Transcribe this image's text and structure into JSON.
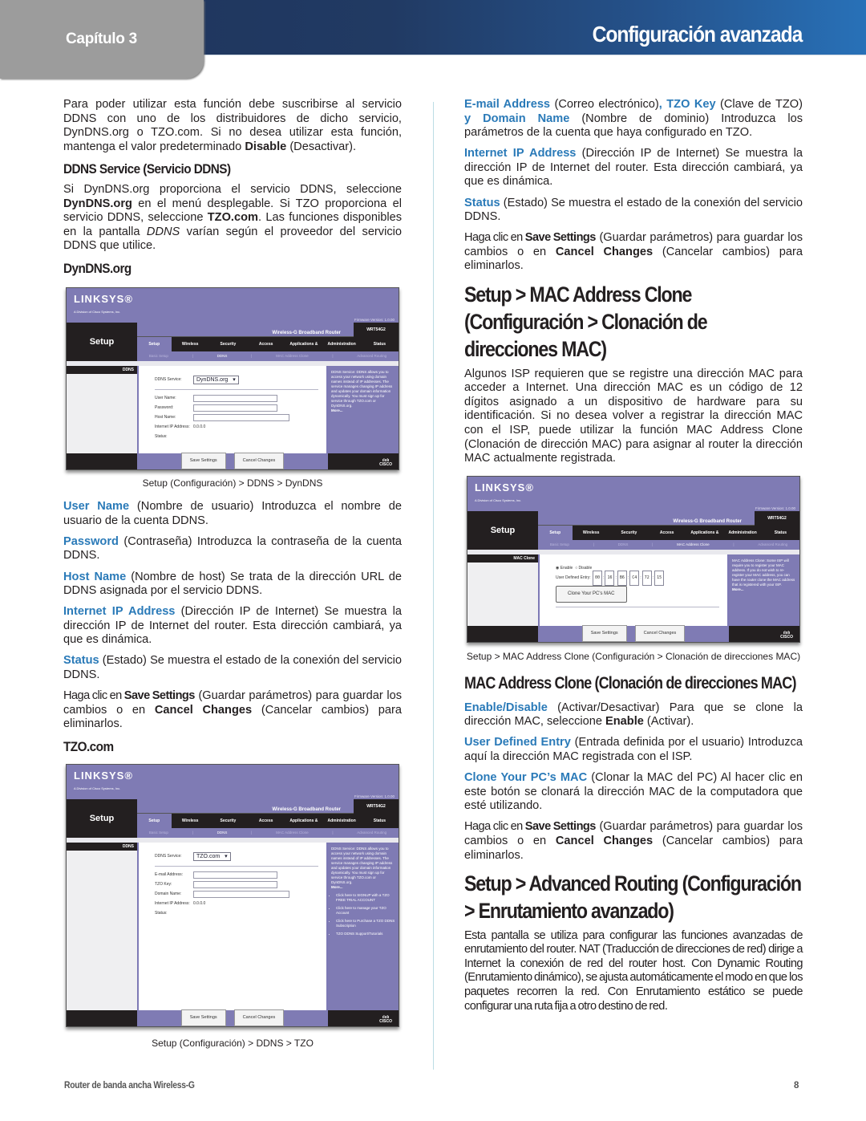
{
  "header": {
    "chapter_label": "Capítulo 3",
    "title": "Configuración avanzada"
  },
  "left": {
    "intro": "Para poder utilizar esta función debe suscribirse al servicio DDNS con uno de los distribuidores de dicho servicio, DynDNS.org o TZO.com. Si no desea utilizar esta función, mantenga el valor predeterminado ",
    "intro_bold": "Disable",
    "intro_tail": " (Desactivar).",
    "ddns_service_heading": "DDNS Service (Servicio DDNS)",
    "ddns_p1": "Si DynDNS.org proporciona el servicio DDNS, seleccione ",
    "ddns_p1_b1": "DynDNS.org",
    "ddns_p1_m": " en el menú desplegable. Si TZO proporciona el servicio DDNS, seleccione ",
    "ddns_p1_b2": "TZO.com",
    "ddns_p1_m2": ". Las funciones disponibles en la pantalla ",
    "ddns_p1_i": "DDNS",
    "ddns_p1_tail": " varían según el proveedor del servicio DDNS que utilice.",
    "dyndns_heading": "DynDNS.org",
    "caption1": "Setup (Configuración) > DDNS > DynDNS",
    "items": [
      {
        "term": "User Name",
        "text": " (Nombre de usuario) Introduzca el nombre de usuario de la cuenta DDNS."
      },
      {
        "term": "Password",
        "text": " (Contraseña) Introduzca la contraseña de la cuenta DDNS."
      },
      {
        "term": "Host Name",
        "text": " (Nombre de host) Se trata de la dirección URL de DDNS asignada por el servicio DDNS."
      },
      {
        "term": "Internet IP Address",
        "text": " (Dirección IP de Internet) Se muestra la dirección IP de Internet del router. Esta dirección cambiará, ya que es dinámica."
      },
      {
        "term": "Status",
        "text": " (Estado) Se muestra el estado de la conexión del servicio DDNS."
      }
    ],
    "save_p": {
      "a": "Haga clic en ",
      "b1": "Save Settings",
      "m": " (Guardar parámetros) para guardar los cambios o en ",
      "b2": "Cancel Changes",
      "t": " (Cancelar cambios) para eliminarlos."
    },
    "tzo_heading": "TZO.com",
    "caption2": "Setup (Configuración) > DDNS > TZO"
  },
  "right": {
    "tzo_p": {
      "t1": "E-mail Address",
      "a": " (Correo electrónico)",
      "t2": ", TZO Key",
      "b": " (Clave de TZO) ",
      "t3": "y Domain Name",
      "c": " (Nombre de dominio)  Introduzca los parámetros de la cuenta que haya configurado en TZO."
    },
    "items": [
      {
        "term": "Internet IP Address",
        "text": " (Dirección IP de Internet) Se muestra la dirección IP de Internet del router. Esta dirección cambiará, ya que es dinámica."
      },
      {
        "term": "Status",
        "text": " (Estado) Se muestra el estado de la conexión del servicio DDNS."
      }
    ],
    "save_p": {
      "a": "Haga clic en ",
      "b1": "Save Settings",
      "m": " (Guardar parámetros) para guardar los cambios o en ",
      "b2": "Cancel Changes",
      "t": " (Cancelar cambios) para eliminarlos."
    },
    "mac_heading": "Setup > MAC Address Clone (Configuración > Clonación de direcciones MAC)",
    "mac_intro": "Algunos ISP requieren que se registre una dirección MAC para acceder a Internet. Una dirección MAC es un código de 12 dígitos asignado a un dispositivo de hardware para su identificación. Si no desea volver a registrar la dirección MAC con el ISP, puede utilizar la función MAC Address Clone (Clonación de dirección MAC) para asignar al router la dirección MAC actualmente registrada.",
    "caption3": "Setup > MAC Address Clone (Configuración > Clonación de direcciones MAC)",
    "mac_sub_heading": "MAC Address Clone (Clonación de direcciones MAC)",
    "mac_items": [
      {
        "term": "Enable/Disable",
        "text": " (Activar/Desactivar) Para que se clone la dirección MAC, seleccione ",
        "bold": "Enable",
        "tail": " (Activar)."
      },
      {
        "term": "User Defined Entry",
        "text": " (Entrada definida por el usuario) Introduzca aquí la dirección MAC registrada con el ISP."
      },
      {
        "term": "Clone Your PC’s MAC",
        "text": "  (Clonar la MAC del PC) Al hacer clic en este botón se clonará la dirección MAC de la computadora que esté utilizando."
      }
    ],
    "save_p2": {
      "a": "Haga clic en ",
      "b1": "Save Settings",
      "m": " (Guardar parámetros) para guardar los cambios o en ",
      "b2": "Cancel Changes",
      "t": " (Cancelar cambios) para eliminarlos."
    },
    "routing_heading": "Setup > Advanced Routing (Configuración > Enrutamiento avanzado)",
    "routing_p": "Esta pantalla se utiliza para configurar las funciones avanzadas de enrutamiento del router. NAT (Traducción de direcciones de red) dirige a Internet la conexión de red del router host. Con Dynamic Routing (Enrutamiento dinámico), se ajusta automáticamente el modo en que los paquetes recorren la red. Con Enrutamiento estático se puede configurar una ruta fija a otro destino de red."
  },
  "router_ui": {
    "logo": "LINKSYS®",
    "logo_sub": "A Division of Cisco Systems, Inc.",
    "firmware": "Firmware Version: 1.0.00",
    "product": "Wireless-G Broadband Router",
    "model": "WRT54G2",
    "section": "Setup",
    "tabs": [
      "Setup",
      "Wireless",
      "Security",
      "Access Restrictions",
      "Applications & Gaming",
      "Administration",
      "Status"
    ],
    "subtabs": [
      "Basic Setup",
      "|",
      "DDNS",
      "|",
      "MAC Address Clone",
      "|",
      "Advanced Routing"
    ],
    "save_btn": "Save Settings",
    "cancel_btn": "Cancel Changes",
    "cisco": "CISCO",
    "dyndns": {
      "side_label": "DDNS",
      "service_label": "DDNS Service:",
      "service_value": "DynDNS.org",
      "fields": [
        "User Name:",
        "Password:",
        "Host Name:"
      ],
      "ip_label": "Internet IP Address:",
      "ip_value": "0.0.0.0",
      "status_label": "Status:",
      "help": "DDNS Service: DDNS allows you to access your network using domain names instead of IP addresses. The service manages changing IP address and updates your domain information dynamically. You must sign up for service through TZO.com or DynDNS.org.",
      "more": "More..."
    },
    "tzo": {
      "side_label": "DDNS",
      "service_label": "DDNS Service:",
      "service_value": "TZO.com",
      "fields": [
        "E-mail Address:",
        "TZO Key:",
        "Domain Name:"
      ],
      "ip_label": "Internet IP Address:",
      "ip_value": "0.0.0.0",
      "status_label": "Status:",
      "help": "DDNS Service: DDNS allows you to access your network using domain names instead of IP addresses. The service manages changing IP address and updates your domain information dynamically. You must sign up for service through TZO.com or DynDNS.org.",
      "more": "More...",
      "links": [
        "Click here to SIGNUP with a TZO FREE TRIAL ACCOUNT",
        "Click here to manage your TZO Account",
        "Click here to Purchase a TZO DDNS Subscription",
        "TZO DDNS Support/Tutorials"
      ]
    },
    "mac": {
      "side_label": "MAC Clone",
      "enable": "Enable",
      "disable": "Disable",
      "selected": "Enable",
      "entry_label": "User Defined Entry:",
      "mac_octets": [
        "00",
        "16",
        "B6",
        "C4",
        "72",
        "15"
      ],
      "clone_btn": "Clone Your PC's MAC",
      "help": "MAC Address Clone: Some ISP will require you to register your MAC address. If you do not wish to re-register your MAC address, you can have the router clone the MAC address that is registered with your ISP.",
      "more": "More..."
    }
  },
  "footer": {
    "product": "Router de banda ancha Wireless-G",
    "page_number": "8"
  }
}
